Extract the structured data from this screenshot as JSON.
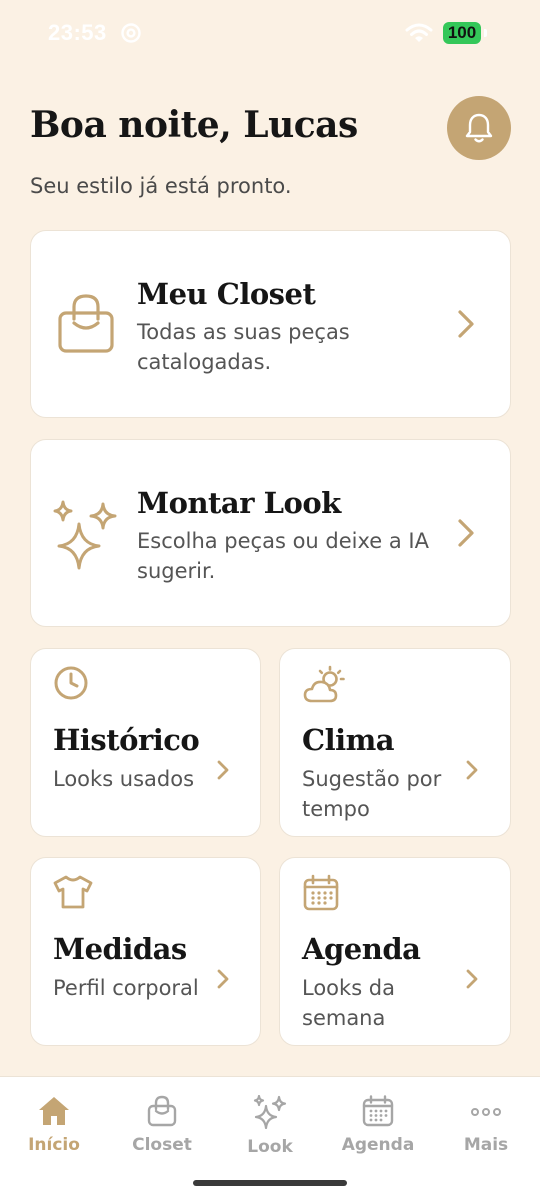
{
  "status": {
    "time": "23:53",
    "battery": "100"
  },
  "header": {
    "greeting": "Boa noite, Lucas",
    "subtitle": "Seu estilo já está pronto."
  },
  "cards": {
    "closet": {
      "title": "Meu Closet",
      "desc": "Todas as suas peças catalogadas.",
      "icon": "shopping-bag-icon"
    },
    "look": {
      "title": "Montar Look",
      "desc": "Escolha peças ou deixe a IA sugerir.",
      "icon": "sparkles-icon"
    },
    "historico": {
      "title": "Histórico",
      "desc": "Looks usados",
      "icon": "clock-icon"
    },
    "clima": {
      "title": "Clima",
      "desc": "Sugestão por tempo",
      "icon": "weather-icon"
    },
    "medidas": {
      "title": "Medidas",
      "desc": "Perfil corporal",
      "icon": "tshirt-icon"
    },
    "agenda": {
      "title": "Agenda",
      "desc": "Looks da semana",
      "icon": "calendar-icon"
    }
  },
  "tabs": [
    {
      "label": "Início",
      "icon": "home-icon",
      "active": true
    },
    {
      "label": "Closet",
      "icon": "bag-icon",
      "active": false
    },
    {
      "label": "Look",
      "icon": "sparkles-icon",
      "active": false
    },
    {
      "label": "Agenda",
      "icon": "calendar-icon",
      "active": false
    },
    {
      "label": "Mais",
      "icon": "more-icon",
      "active": false
    }
  ],
  "colors": {
    "accent": "#C4A574",
    "background": "#FBF1E4",
    "card": "#FFFFFF",
    "inactive": "#A6A6A6"
  }
}
